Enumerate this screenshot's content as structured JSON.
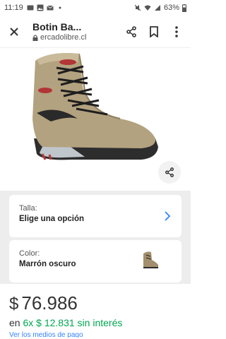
{
  "status": {
    "time": "11:19",
    "battery": "63%"
  },
  "toolbar": {
    "title": "Botin Ba...",
    "domain": "ercadolibre.cl",
    "icons": [
      "close-icon",
      "lock-icon",
      "share-icon",
      "bookmark-icon",
      "more-vertical-icon"
    ]
  },
  "product": {
    "image": "brown-hiking-boot"
  },
  "variations": {
    "size": {
      "label": "Talla:",
      "value": "Elige una opción"
    },
    "color": {
      "label": "Color:",
      "value": "Marrón oscuro"
    }
  },
  "price": {
    "currency": "$",
    "amount": "76.986",
    "installments_prefix": "en",
    "installments_count": "6x",
    "installments_amount": "$ 12.831",
    "installments_suffix": "sin interés",
    "payment_link": "Ver los medios de pago"
  },
  "colors": {
    "accent_blue": "#3483fa",
    "green": "#00a650"
  }
}
